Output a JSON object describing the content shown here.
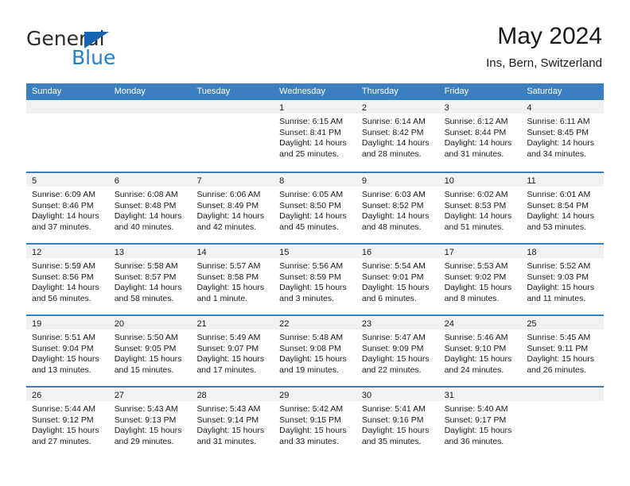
{
  "brand": {
    "name_part1": "General",
    "name_part2": "Blue",
    "triangle_color": "#1565b0",
    "blue_color": "#1f7fd0"
  },
  "header": {
    "title": "May 2024",
    "subtitle": "Ins, Bern, Switzerland"
  },
  "theme": {
    "header_blue": "#3c7fc1",
    "day_band_gray": "#f2f2f2"
  },
  "weekdays": [
    "Sunday",
    "Monday",
    "Tuesday",
    "Wednesday",
    "Thursday",
    "Friday",
    "Saturday"
  ],
  "weeks": [
    [
      {
        "day": "",
        "empty": true,
        "sunrise": "",
        "sunset": "",
        "daylight": ""
      },
      {
        "day": "",
        "empty": true,
        "sunrise": "",
        "sunset": "",
        "daylight": ""
      },
      {
        "day": "",
        "empty": true,
        "sunrise": "",
        "sunset": "",
        "daylight": ""
      },
      {
        "day": "1",
        "empty": false,
        "sunrise": "Sunrise: 6:15 AM",
        "sunset": "Sunset: 8:41 PM",
        "daylight": "Daylight: 14 hours and 25 minutes."
      },
      {
        "day": "2",
        "empty": false,
        "sunrise": "Sunrise: 6:14 AM",
        "sunset": "Sunset: 8:42 PM",
        "daylight": "Daylight: 14 hours and 28 minutes."
      },
      {
        "day": "3",
        "empty": false,
        "sunrise": "Sunrise: 6:12 AM",
        "sunset": "Sunset: 8:44 PM",
        "daylight": "Daylight: 14 hours and 31 minutes."
      },
      {
        "day": "4",
        "empty": false,
        "sunrise": "Sunrise: 6:11 AM",
        "sunset": "Sunset: 8:45 PM",
        "daylight": "Daylight: 14 hours and 34 minutes."
      }
    ],
    [
      {
        "day": "5",
        "empty": false,
        "sunrise": "Sunrise: 6:09 AM",
        "sunset": "Sunset: 8:46 PM",
        "daylight": "Daylight: 14 hours and 37 minutes."
      },
      {
        "day": "6",
        "empty": false,
        "sunrise": "Sunrise: 6:08 AM",
        "sunset": "Sunset: 8:48 PM",
        "daylight": "Daylight: 14 hours and 40 minutes."
      },
      {
        "day": "7",
        "empty": false,
        "sunrise": "Sunrise: 6:06 AM",
        "sunset": "Sunset: 8:49 PM",
        "daylight": "Daylight: 14 hours and 42 minutes."
      },
      {
        "day": "8",
        "empty": false,
        "sunrise": "Sunrise: 6:05 AM",
        "sunset": "Sunset: 8:50 PM",
        "daylight": "Daylight: 14 hours and 45 minutes."
      },
      {
        "day": "9",
        "empty": false,
        "sunrise": "Sunrise: 6:03 AM",
        "sunset": "Sunset: 8:52 PM",
        "daylight": "Daylight: 14 hours and 48 minutes."
      },
      {
        "day": "10",
        "empty": false,
        "sunrise": "Sunrise: 6:02 AM",
        "sunset": "Sunset: 8:53 PM",
        "daylight": "Daylight: 14 hours and 51 minutes."
      },
      {
        "day": "11",
        "empty": false,
        "sunrise": "Sunrise: 6:01 AM",
        "sunset": "Sunset: 8:54 PM",
        "daylight": "Daylight: 14 hours and 53 minutes."
      }
    ],
    [
      {
        "day": "12",
        "empty": false,
        "sunrise": "Sunrise: 5:59 AM",
        "sunset": "Sunset: 8:56 PM",
        "daylight": "Daylight: 14 hours and 56 minutes."
      },
      {
        "day": "13",
        "empty": false,
        "sunrise": "Sunrise: 5:58 AM",
        "sunset": "Sunset: 8:57 PM",
        "daylight": "Daylight: 14 hours and 58 minutes."
      },
      {
        "day": "14",
        "empty": false,
        "sunrise": "Sunrise: 5:57 AM",
        "sunset": "Sunset: 8:58 PM",
        "daylight": "Daylight: 15 hours and 1 minute."
      },
      {
        "day": "15",
        "empty": false,
        "sunrise": "Sunrise: 5:56 AM",
        "sunset": "Sunset: 8:59 PM",
        "daylight": "Daylight: 15 hours and 3 minutes."
      },
      {
        "day": "16",
        "empty": false,
        "sunrise": "Sunrise: 5:54 AM",
        "sunset": "Sunset: 9:01 PM",
        "daylight": "Daylight: 15 hours and 6 minutes."
      },
      {
        "day": "17",
        "empty": false,
        "sunrise": "Sunrise: 5:53 AM",
        "sunset": "Sunset: 9:02 PM",
        "daylight": "Daylight: 15 hours and 8 minutes."
      },
      {
        "day": "18",
        "empty": false,
        "sunrise": "Sunrise: 5:52 AM",
        "sunset": "Sunset: 9:03 PM",
        "daylight": "Daylight: 15 hours and 11 minutes."
      }
    ],
    [
      {
        "day": "19",
        "empty": false,
        "sunrise": "Sunrise: 5:51 AM",
        "sunset": "Sunset: 9:04 PM",
        "daylight": "Daylight: 15 hours and 13 minutes."
      },
      {
        "day": "20",
        "empty": false,
        "sunrise": "Sunrise: 5:50 AM",
        "sunset": "Sunset: 9:05 PM",
        "daylight": "Daylight: 15 hours and 15 minutes."
      },
      {
        "day": "21",
        "empty": false,
        "sunrise": "Sunrise: 5:49 AM",
        "sunset": "Sunset: 9:07 PM",
        "daylight": "Daylight: 15 hours and 17 minutes."
      },
      {
        "day": "22",
        "empty": false,
        "sunrise": "Sunrise: 5:48 AM",
        "sunset": "Sunset: 9:08 PM",
        "daylight": "Daylight: 15 hours and 19 minutes."
      },
      {
        "day": "23",
        "empty": false,
        "sunrise": "Sunrise: 5:47 AM",
        "sunset": "Sunset: 9:09 PM",
        "daylight": "Daylight: 15 hours and 22 minutes."
      },
      {
        "day": "24",
        "empty": false,
        "sunrise": "Sunrise: 5:46 AM",
        "sunset": "Sunset: 9:10 PM",
        "daylight": "Daylight: 15 hours and 24 minutes."
      },
      {
        "day": "25",
        "empty": false,
        "sunrise": "Sunrise: 5:45 AM",
        "sunset": "Sunset: 9:11 PM",
        "daylight": "Daylight: 15 hours and 26 minutes."
      }
    ],
    [
      {
        "day": "26",
        "empty": false,
        "sunrise": "Sunrise: 5:44 AM",
        "sunset": "Sunset: 9:12 PM",
        "daylight": "Daylight: 15 hours and 27 minutes."
      },
      {
        "day": "27",
        "empty": false,
        "sunrise": "Sunrise: 5:43 AM",
        "sunset": "Sunset: 9:13 PM",
        "daylight": "Daylight: 15 hours and 29 minutes."
      },
      {
        "day": "28",
        "empty": false,
        "sunrise": "Sunrise: 5:43 AM",
        "sunset": "Sunset: 9:14 PM",
        "daylight": "Daylight: 15 hours and 31 minutes."
      },
      {
        "day": "29",
        "empty": false,
        "sunrise": "Sunrise: 5:42 AM",
        "sunset": "Sunset: 9:15 PM",
        "daylight": "Daylight: 15 hours and 33 minutes."
      },
      {
        "day": "30",
        "empty": false,
        "sunrise": "Sunrise: 5:41 AM",
        "sunset": "Sunset: 9:16 PM",
        "daylight": "Daylight: 15 hours and 35 minutes."
      },
      {
        "day": "31",
        "empty": false,
        "sunrise": "Sunrise: 5:40 AM",
        "sunset": "Sunset: 9:17 PM",
        "daylight": "Daylight: 15 hours and 36 minutes."
      },
      {
        "day": "",
        "empty": true,
        "sunrise": "",
        "sunset": "",
        "daylight": ""
      }
    ]
  ]
}
